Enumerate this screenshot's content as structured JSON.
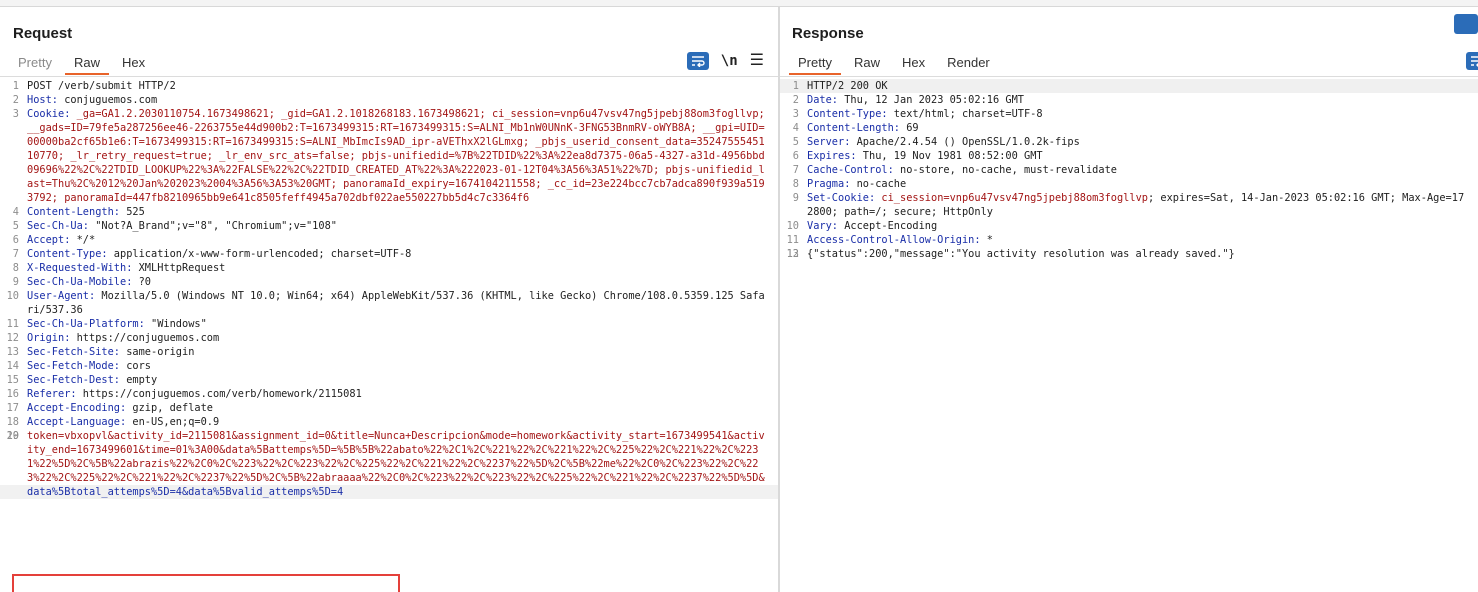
{
  "request": {
    "title": "Request",
    "tabs": [
      "Pretty",
      "Raw",
      "Hex"
    ],
    "active_tab": "Raw",
    "toolbar": {
      "newline_toggle": "\\n",
      "menu": "☰"
    },
    "lines": [
      {
        "n": "1",
        "t": "POST /verb/submit HTTP/2",
        "kind": "plain"
      },
      {
        "n": "2",
        "h": "Host:",
        "v": " conjuguemos.com",
        "kind": "header",
        "vc": "dark"
      },
      {
        "n": "3",
        "h": "Cookie:",
        "v": " _ga=GA1.2.2030110754.1673498621; _gid=GA1.2.1018268183.1673498621; ci_session=vnp6u47vsv47ng5jpebj88om3fogllvp; __gads=ID=79fe5a287256ee46-2263755e44d900b2:T=1673499315:RT=1673499315:S=ALNI_Mb1nW0UNnK-3FNG53BnmRV-oWYB8A; __gpi=UID=00000ba2cf65b1e6:T=1673499315:RT=1673499315:S=ALNI_MbImcIs9AD_ipr-aVEThxX2lGLmxg; _pbjs_userid_consent_data=3524755545110770; _lr_retry_request=true; _lr_env_src_ats=false; pbjs-unifiedid=%7B%22TDID%22%3A%22ea8d7375-06a5-4327-a31d-4956bbd09696%22%2C%22TDID_LOOKUP%22%3A%22FALSE%22%2C%22TDID_CREATED_AT%22%3A%222023-01-12T04%3A56%3A51%22%7D; pbjs-unifiedid_last=Thu%2C%2012%20Jan%202023%2004%3A56%3A53%20GMT; panoramaId_expiry=1674104211558; _cc_id=23e224bcc7cb7adca890f939a5193792; panoramaId=447fb8210965bb9e641c8505feff4945a702dbf022ae550227bb5d4c7c3364f6",
        "kind": "header",
        "vc": "red"
      },
      {
        "n": "4",
        "h": "Content-Length:",
        "v": " 525",
        "kind": "header",
        "vc": "dark"
      },
      {
        "n": "5",
        "h": "Sec-Ch-Ua:",
        "v": " \"Not?A_Brand\";v=\"8\", \"Chromium\";v=\"108\"",
        "kind": "header",
        "vc": "dark"
      },
      {
        "n": "6",
        "h": "Accept:",
        "v": " */*",
        "kind": "header",
        "vc": "dark"
      },
      {
        "n": "7",
        "h": "Content-Type:",
        "v": " application/x-www-form-urlencoded; charset=UTF-8",
        "kind": "header",
        "vc": "dark"
      },
      {
        "n": "8",
        "h": "X-Requested-With:",
        "v": " XMLHttpRequest",
        "kind": "header",
        "vc": "dark"
      },
      {
        "n": "9",
        "h": "Sec-Ch-Ua-Mobile:",
        "v": " ?0",
        "kind": "header",
        "vc": "dark"
      },
      {
        "n": "10",
        "h": "User-Agent:",
        "v": " Mozilla/5.0 (Windows NT 10.0; Win64; x64) AppleWebKit/537.36 (KHTML, like Gecko) Chrome/108.0.5359.125 Safari/537.36",
        "kind": "header",
        "vc": "dark"
      },
      {
        "n": "11",
        "h": "Sec-Ch-Ua-Platform:",
        "v": " \"Windows\"",
        "kind": "header",
        "vc": "dark"
      },
      {
        "n": "12",
        "h": "Origin:",
        "v": " https://conjuguemos.com",
        "kind": "header",
        "vc": "dark"
      },
      {
        "n": "13",
        "h": "Sec-Fetch-Site:",
        "v": " same-origin",
        "kind": "header",
        "vc": "dark"
      },
      {
        "n": "14",
        "h": "Sec-Fetch-Mode:",
        "v": " cors",
        "kind": "header",
        "vc": "dark"
      },
      {
        "n": "15",
        "h": "Sec-Fetch-Dest:",
        "v": " empty",
        "kind": "header",
        "vc": "dark"
      },
      {
        "n": "16",
        "h": "Referer:",
        "v": " https://conjuguemos.com/verb/homework/2115081",
        "kind": "header",
        "vc": "dark"
      },
      {
        "n": "17",
        "h": "Accept-Encoding:",
        "v": " gzip, deflate",
        "kind": "header",
        "vc": "dark"
      },
      {
        "n": "18",
        "h": "Accept-Language:",
        "v": " en-US,en;q=0.9",
        "kind": "header",
        "vc": "dark"
      },
      {
        "n": "19",
        "t": "",
        "kind": "plain"
      },
      {
        "n": "20",
        "t": "token=vbxopvl&activity_id=2115081&assignment_id=0&title=Nunca+Descripcion&mode=homework&activity_start=1673499541&activity_end=1673499601&time=01%3A00&data%5Battemps%5D=%5B%5B%22abato%22%2C1%2C%221%22%2C%221%22%2C%225%22%2C%221%22%2C%2231%22%5D%2C%5B%22abrazis%22%2C0%2C%223%22%2C%223%22%2C%225%22%2C%221%22%2C%2237%22%5D%2C%5B%22me%22%2C0%2C%223%22%2C%223%22%2C%225%22%2C%221%22%2C%2237%22%5D%2C%5B%22abraaaa%22%2C0%2C%223%22%2C%223%22%2C%225%22%2C%221%22%2C%2237%22%5D%5D&",
        "kind": "body"
      },
      {
        "n": "",
        "t": "data%5Btotal_attemps%5D=4&data%5Bvalid_attemps%5D=4",
        "kind": "body-cur"
      }
    ]
  },
  "response": {
    "title": "Response",
    "tabs": [
      "Pretty",
      "Raw",
      "Hex",
      "Render"
    ],
    "active_tab": "Pretty",
    "lines": [
      {
        "n": "1",
        "t": "HTTP/2 200 OK",
        "kind": "status"
      },
      {
        "n": "2",
        "h": "Date:",
        "v": " Thu, 12 Jan 2023 05:02:16 GMT",
        "kind": "header",
        "vc": "dark"
      },
      {
        "n": "3",
        "h": "Content-Type:",
        "v": " text/html; charset=UTF-8",
        "kind": "header",
        "vc": "dark"
      },
      {
        "n": "4",
        "h": "Content-Length:",
        "v": " 69",
        "kind": "header",
        "vc": "dark"
      },
      {
        "n": "5",
        "h": "Server:",
        "v": " Apache/2.4.54 () OpenSSL/1.0.2k-fips",
        "kind": "header",
        "vc": "dark"
      },
      {
        "n": "6",
        "h": "Expires:",
        "v": " Thu, 19 Nov 1981 08:52:00 GMT",
        "kind": "header",
        "vc": "dark"
      },
      {
        "n": "7",
        "h": "Cache-Control:",
        "v": " no-store, no-cache, must-revalidate",
        "kind": "header",
        "vc": "dark"
      },
      {
        "n": "8",
        "h": "Pragma:",
        "v": " no-cache",
        "kind": "header",
        "vc": "dark"
      },
      {
        "n": "9",
        "h": "Set-Cookie:",
        "v": " ci_session=vnp6u47vsv47ng5jpebj88om3fogllvp; expires=Sat, 14-Jan-2023 05:02:16 GMT; Max-Age=172800; path=/; secure; HttpOnly",
        "kind": "header",
        "vc": "mixed"
      },
      {
        "n": "10",
        "h": "Vary:",
        "v": " Accept-Encoding",
        "kind": "header",
        "vc": "dark"
      },
      {
        "n": "11",
        "h": "Access-Control-Allow-Origin:",
        "v": " *",
        "kind": "header",
        "vc": "dark"
      },
      {
        "n": "12",
        "t": "",
        "kind": "plain"
      },
      {
        "n": "13",
        "t": "{\"status\":200,\"message\":\"You activity resolution was already saved.\"}",
        "kind": "plain"
      }
    ]
  },
  "colors": {
    "accent": "#e8632a",
    "header_name": "#1a2ea8",
    "value_red": "#a31515",
    "toggle_blue": "#2b6cb8",
    "highlight": "#e4403a"
  },
  "icons": {
    "wrap": "wrap-lines-icon",
    "layout": "layout-toggle-icon"
  }
}
